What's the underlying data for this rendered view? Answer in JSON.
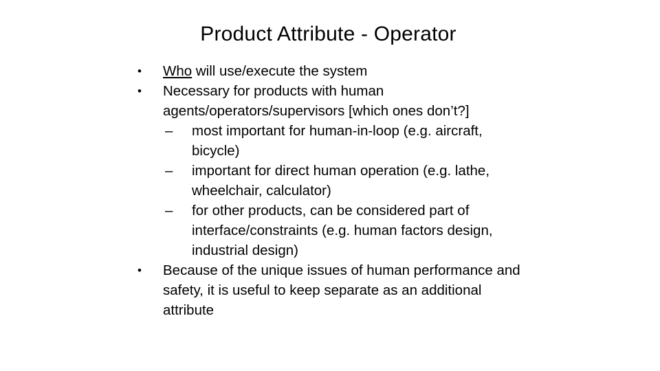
{
  "slide": {
    "title": "Product Attribute - Operator",
    "bullets": [
      {
        "marker": "•",
        "underlined_lead": "Who",
        "text": " will use/execute the system"
      },
      {
        "marker": "•",
        "line1": "Necessary for products with human",
        "line2": "agents/operators/supervisors [which ones don’t?]",
        "sub": [
          {
            "marker": "–",
            "line1": "most important for human-in-loop (e.g. aircraft,",
            "line2": "bicycle)"
          },
          {
            "marker": "–",
            "line1": "important for direct human operation (e.g. lathe,",
            "line2": "wheelchair, calculator)"
          },
          {
            "marker": "–",
            "line1": "for other products, can be considered part of",
            "line2": "interface/constraints (e.g. human factors design,",
            "line3": "industrial design)"
          }
        ]
      },
      {
        "marker": "•",
        "line1": "Because of the unique issues of human performance and",
        "line2": "safety, it is useful to keep separate as an additional",
        "line3": "attribute"
      }
    ]
  }
}
